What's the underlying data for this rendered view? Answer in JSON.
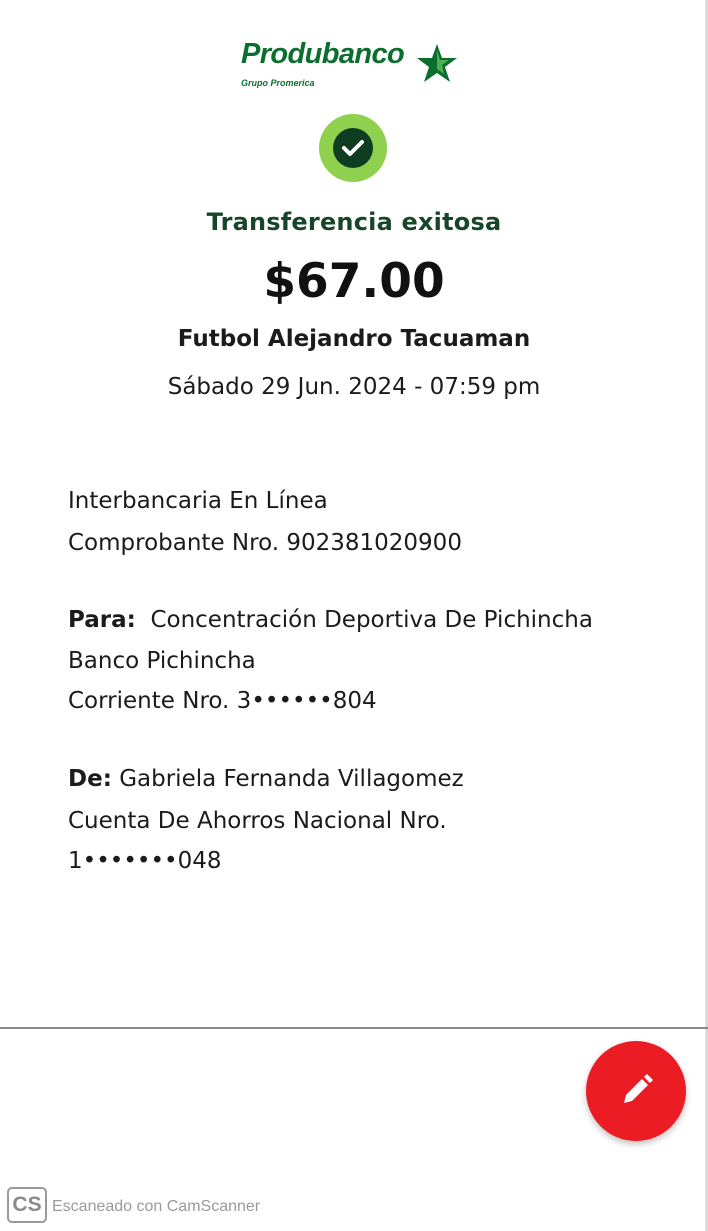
{
  "brand": {
    "name": "Produbanco",
    "subtitle": "Grupo Promerica",
    "color": "#0c6e2e"
  },
  "receipt": {
    "status": "Transferencia exitosa",
    "amount": "$67.00",
    "description": "Futbol Alejandro Tacuaman",
    "datetime": "Sábado 29 Jun. 2024 - 07:59 pm",
    "channel": "Interbancaria En Línea",
    "voucher": "Comprobante Nro. 902381020900",
    "to": {
      "label": "Para:",
      "name": "Concentración Deportiva De Pichincha",
      "bank": "Banco Pichincha",
      "account": "Corriente Nro. 3••••••804"
    },
    "from": {
      "label": "De:",
      "name": "Gabriela Fernanda Villagomez",
      "account_type": "Cuenta De Ahorros Nacional Nro.",
      "account_number": "1•••••••048"
    }
  },
  "actions": {
    "edit_icon": "pencil-icon",
    "accent": "#ec1c24"
  },
  "watermark": {
    "badge": "CS",
    "text": "Escaneado con CamScanner"
  }
}
